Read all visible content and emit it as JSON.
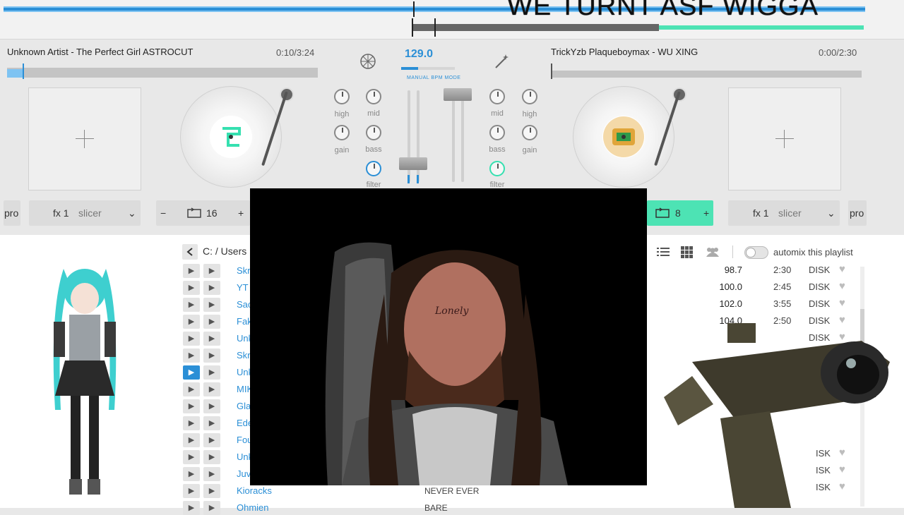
{
  "overlay": {
    "caption": "WE TURNT ASF WIGGA"
  },
  "deck_left": {
    "title": "Unknown Artist - The Perfect Girl ASTROCUT",
    "time": "0:10/3:24",
    "fx": "fx 1",
    "fx_mode": "slicer",
    "loop_value": "16",
    "pro_label": "pro",
    "minus": "−",
    "plus": "+"
  },
  "deck_right": {
    "title": "TrickYzb Plaqueboymax - WU XING",
    "time": "0:00/2:30",
    "fx": "fx 1",
    "fx_mode": "slicer",
    "loop_value": "8",
    "pro_label": "pro",
    "plus": "+"
  },
  "mixer": {
    "bpm": "129.0",
    "bpm_mode": "MANUAL BPM MODE",
    "labels": {
      "high": "high",
      "mid": "mid",
      "gain": "gain",
      "bass": "bass",
      "filter": "filter"
    }
  },
  "library": {
    "breadcrumb": "C: / Users",
    "automix_label": "automix this playlist",
    "tracks": [
      {
        "name": "Skr"
      },
      {
        "name": "YT"
      },
      {
        "name": "Sac"
      },
      {
        "name": "Fak"
      },
      {
        "name": "Unk"
      },
      {
        "name": "Skr"
      },
      {
        "name": "Unk"
      },
      {
        "name": "MIK"
      },
      {
        "name": "Gla"
      },
      {
        "name": "Ede"
      },
      {
        "name": "Fou"
      },
      {
        "name": "Unk"
      },
      {
        "name": "Juv"
      },
      {
        "name": "Kioracks",
        "artist": "NEVER EVER"
      },
      {
        "name": "Ohmien",
        "artist": "BARE"
      }
    ],
    "right_rows": [
      {
        "bpm": "98.7",
        "dur": "2:30",
        "src": "DISK"
      },
      {
        "bpm": "100.0",
        "dur": "2:45",
        "src": "DISK"
      },
      {
        "bpm": "102.0",
        "dur": "3:55",
        "src": "DISK"
      },
      {
        "bpm": "104.0",
        "dur": "2:50",
        "src": "DISK"
      },
      {
        "bpm": "",
        "dur": "",
        "src": "DISK"
      }
    ],
    "right_tail": [
      "ISK",
      "ISK",
      "ISK"
    ]
  },
  "colors": {
    "accent_blue": "#2b8fd6",
    "accent_green": "#4de3b4"
  },
  "icons": [
    "back-chevron-icon",
    "list-view-icon",
    "grid-view-icon",
    "people-icon",
    "loop-icon",
    "play-icon",
    "heart-icon",
    "sync-icon",
    "fx-wand-icon"
  ]
}
